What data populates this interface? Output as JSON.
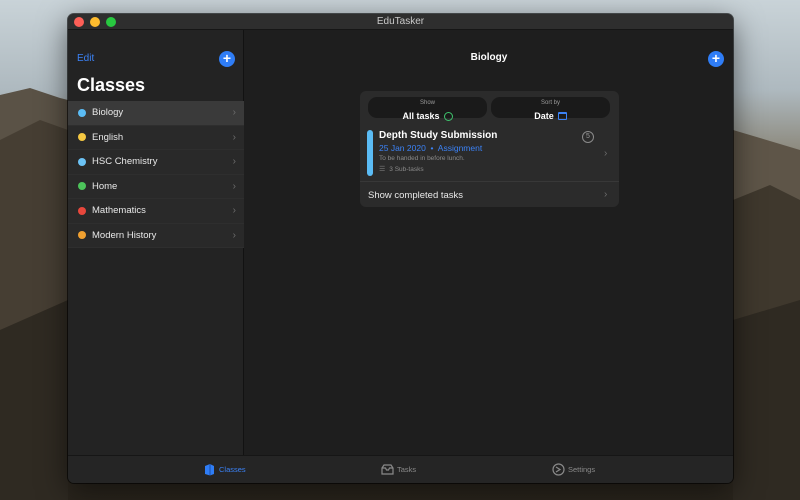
{
  "window": {
    "title": "EduTasker"
  },
  "sidebar": {
    "edit_label": "Edit",
    "add_symbol": "+",
    "heading": "Classes",
    "items": [
      {
        "label": "Biology",
        "color": "#5bbcf5",
        "selected": true
      },
      {
        "label": "English",
        "color": "#f5c842",
        "selected": false
      },
      {
        "label": "HSC Chemistry",
        "color": "#6cc3f5",
        "selected": false
      },
      {
        "label": "Home",
        "color": "#4cc35a",
        "selected": false
      },
      {
        "label": "Mathematics",
        "color": "#e8473c",
        "selected": false
      },
      {
        "label": "Modern History",
        "color": "#f0a030",
        "selected": false
      }
    ]
  },
  "main": {
    "title": "Biology",
    "add_symbol": "+",
    "filter": {
      "small_label": "Show",
      "value": "All tasks"
    },
    "sort": {
      "small_label": "Sort by",
      "value": "Date"
    },
    "task": {
      "title": "Depth Study Submission",
      "date": "25 Jan 2020",
      "separator": "•",
      "type": "Assignment",
      "note": "To be handed in before lunch.",
      "subtasks": "3 Sub-tasks",
      "count": "5",
      "color": "#5bbcf5"
    },
    "show_completed": "Show completed tasks"
  },
  "tabbar": {
    "tabs": [
      {
        "label": "Classes",
        "icon": "classes-icon",
        "active": true
      },
      {
        "label": "Tasks",
        "icon": "tasks-icon",
        "active": false
      },
      {
        "label": "Settings",
        "icon": "settings-icon",
        "active": false
      }
    ]
  },
  "colors": {
    "accent": "#2f7df6",
    "window_bg": "#1e1e1e",
    "sidebar_bg": "#232323"
  }
}
